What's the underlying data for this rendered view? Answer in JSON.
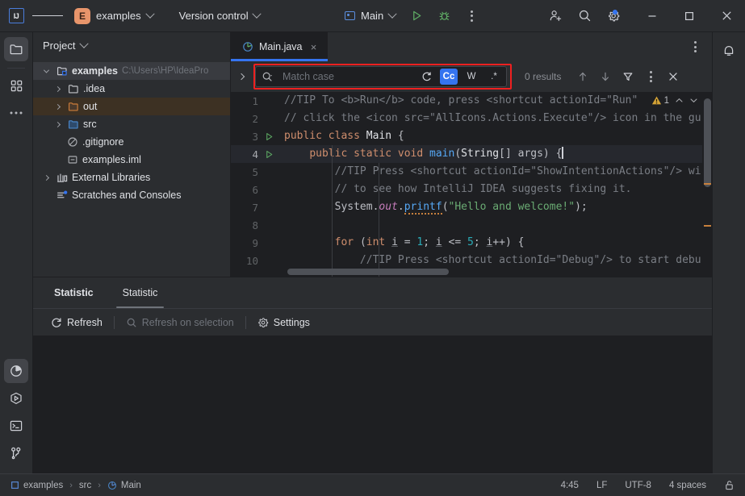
{
  "titlebar": {
    "logo_text": "IJ",
    "logo_name": "intellij-logo-icon",
    "menu_name": "hamburger-menu-icon",
    "project_badge": "E",
    "project_name": "examples",
    "vcs_label": "Version control",
    "run_config": "Main",
    "run_button": "run-icon",
    "debug_button": "debug-icon",
    "more_button": "more-vertical-icon",
    "account_button": "add-account-icon",
    "search_button": "search-icon",
    "settings_button": "gear-icon",
    "minimize": "minimize-icon",
    "maximize": "maximize-icon",
    "close": "close-icon"
  },
  "left_rail": {
    "items": [
      {
        "name": "project-tool-window",
        "icon": "folder-icon",
        "selected": true
      },
      {
        "name": "structure-tool-window",
        "icon": "structure-grid-icon",
        "selected": false
      },
      {
        "name": "more-tool-windows",
        "icon": "more-horizontal-icon",
        "selected": false
      }
    ],
    "bottom_items": [
      {
        "name": "statistic-tool-window",
        "icon": "pie-chart-icon",
        "selected": true
      },
      {
        "name": "run-tool-window",
        "icon": "run-hex-icon",
        "selected": false
      },
      {
        "name": "terminal-tool-window",
        "icon": "terminal-icon",
        "selected": false
      },
      {
        "name": "git-tool-window",
        "icon": "git-branch-icon",
        "selected": false
      }
    ]
  },
  "right_rail": {
    "notifications": "bell-icon"
  },
  "project_panel": {
    "title": "Project",
    "tree": [
      {
        "label": "examples",
        "path": "C:\\Users\\HP\\IdeaPro",
        "icon": "project-module-icon",
        "arrow": "down",
        "indent": 0,
        "bold": true,
        "state": "selected-soft"
      },
      {
        "label": ".idea",
        "path": "",
        "icon": "folder-grey-icon",
        "arrow": "right",
        "indent": 1,
        "bold": false,
        "state": ""
      },
      {
        "label": "out",
        "path": "",
        "icon": "folder-orange-icon",
        "arrow": "right",
        "indent": 1,
        "bold": false,
        "state": "selected-out"
      },
      {
        "label": "src",
        "path": "",
        "icon": "folder-blue-icon",
        "arrow": "right",
        "indent": 1,
        "bold": false,
        "state": ""
      },
      {
        "label": ".gitignore",
        "path": "",
        "icon": "gitignore-icon",
        "arrow": "none",
        "indent": 2,
        "bold": false,
        "state": ""
      },
      {
        "label": "examples.iml",
        "path": "",
        "icon": "iml-file-icon",
        "arrow": "none",
        "indent": 2,
        "bold": false,
        "state": ""
      },
      {
        "label": "External Libraries",
        "path": "",
        "icon": "library-icon",
        "arrow": "right",
        "indent": 0,
        "bold": false,
        "state": ""
      },
      {
        "label": "Scratches and Consoles",
        "path": "",
        "icon": "scratches-icon",
        "arrow": "none",
        "indent": 0,
        "bold": false,
        "state": ""
      }
    ]
  },
  "editor": {
    "tab_label": "Main.java",
    "tab_icon": "java-class-icon",
    "tab_close": "close-icon",
    "tabbar_more": "more-vertical-icon",
    "warning_count": "1",
    "warning_icon": "warning-triangle-icon",
    "lines": [
      {
        "num": "1",
        "run": false,
        "current": false
      },
      {
        "num": "2",
        "run": false,
        "current": false
      },
      {
        "num": "3",
        "run": true,
        "current": false
      },
      {
        "num": "4",
        "run": true,
        "current": true
      },
      {
        "num": "5",
        "run": false,
        "current": false
      },
      {
        "num": "6",
        "run": false,
        "current": false
      },
      {
        "num": "7",
        "run": false,
        "current": false
      },
      {
        "num": "8",
        "run": false,
        "current": false
      },
      {
        "num": "9",
        "run": false,
        "current": false
      },
      {
        "num": "10",
        "run": false,
        "current": false
      }
    ],
    "code_text": [
      "//TIP To <b>Run</b> code, press <shortcut actionId=\"Run\"",
      "// click the <icon src=\"AllIcons.Actions.Execute\"/> icon in the gu",
      "public class Main {",
      "    public static void main(String[] args) {",
      "        //TIP Press <shortcut actionId=\"ShowIntentionActions\"/> wi",
      "        // to see how IntelliJ IDEA suggests fixing it.",
      "        System.out.printf(\"Hello and welcome!\");",
      "",
      "        for (int i = 1; i <= 5; i++) {",
      "            //TIP Press <shortcut actionId=\"Debug\"/> to start debu"
    ]
  },
  "find_bar": {
    "expand_icon": "chevron-right-icon",
    "search_icon": "search-dropdown-icon",
    "field_text": "Match case",
    "field_placeholder": "Match case",
    "preserve_case_icon": "preserve-case-icon",
    "toggles": [
      {
        "name": "match-case-toggle",
        "label": "Cc",
        "active": true
      },
      {
        "name": "words-toggle",
        "label": "W",
        "active": false
      },
      {
        "name": "regex-toggle",
        "label": ".*",
        "active": false
      }
    ],
    "results_text": "0 results",
    "prev_icon": "arrow-up-icon",
    "next_icon": "arrow-down-icon",
    "filter_icon": "filter-icon",
    "more_icon": "more-vertical-icon",
    "close_icon": "close-icon",
    "highlight_color": "#ef2020"
  },
  "statistic_panel": {
    "tabs": [
      {
        "label": "Statistic",
        "name": "statistic-title",
        "bold": true,
        "selected": false
      },
      {
        "label": "Statistic",
        "name": "tab-statistic",
        "bold": false,
        "selected": true
      }
    ],
    "toolbar": [
      {
        "label": "Refresh",
        "name": "refresh-button",
        "icon": "refresh-icon",
        "disabled": false
      },
      {
        "label": "Refresh on selection",
        "name": "refresh-on-selection-button",
        "icon": "search-icon",
        "disabled": true
      },
      {
        "label": "Settings",
        "name": "settings-button",
        "icon": "gear-icon",
        "disabled": false
      }
    ]
  },
  "statusbar": {
    "breadcrumbs": [
      {
        "label": "examples",
        "icon": "module-icon"
      },
      {
        "label": "src",
        "icon": ""
      },
      {
        "label": "Main",
        "icon": "java-class-icon"
      }
    ],
    "separator": "›",
    "caret_position": "4:45",
    "line_separator": "LF",
    "encoding": "UTF-8",
    "indent": "4 spaces",
    "lock_icon": "unlock-icon"
  },
  "colors": {
    "accent": "#3574f0",
    "highlight_red": "#ef2020",
    "bg_dark": "#1e1f22",
    "bg_panel": "#2b2d30",
    "folder_orange": "#cd7d3a",
    "folder_blue": "#4a87c9",
    "warning": "#d4a336"
  }
}
